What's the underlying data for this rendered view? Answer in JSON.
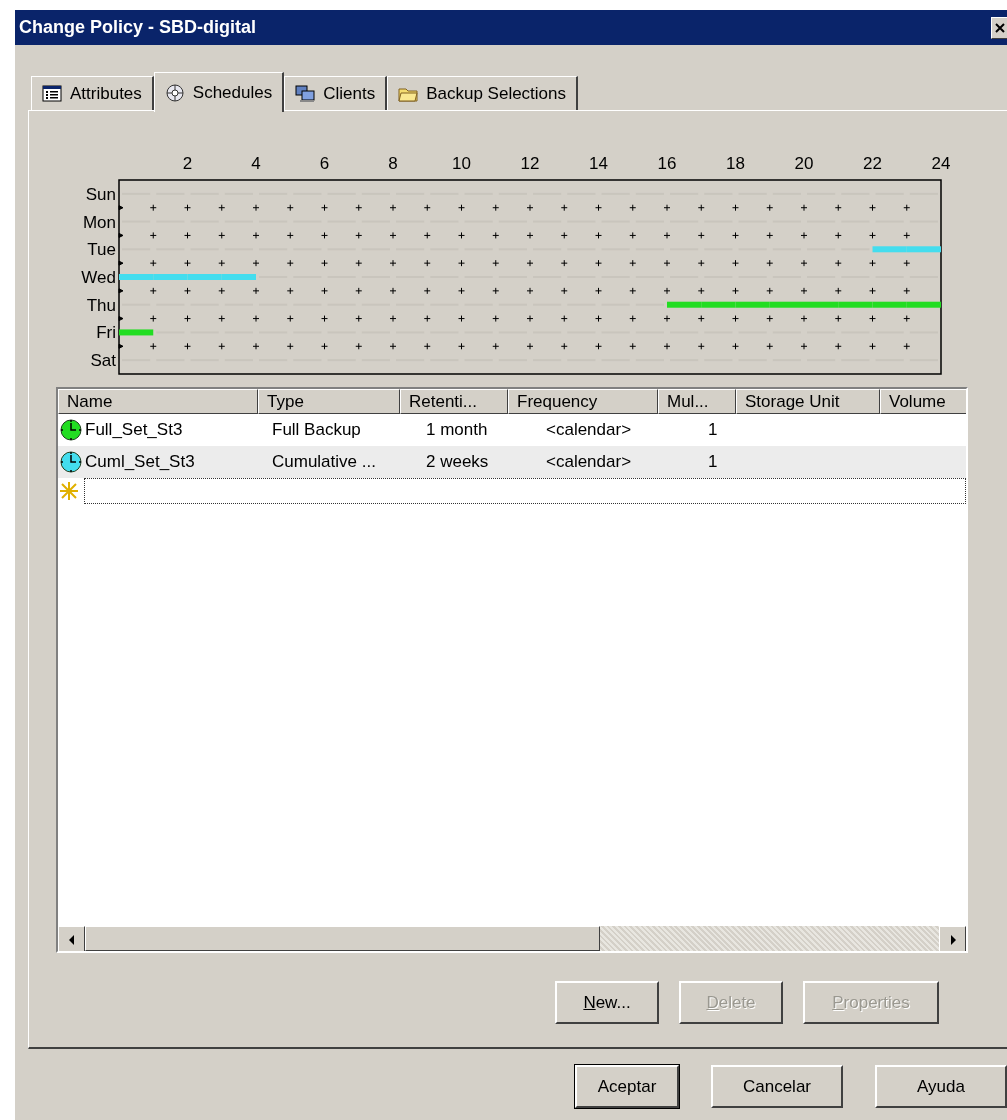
{
  "window": {
    "title": "Change Policy - SBD-digital"
  },
  "tabs": [
    {
      "label": "Attributes",
      "selected": false
    },
    {
      "label": "Schedules",
      "selected": true
    },
    {
      "label": "Clients",
      "selected": false
    },
    {
      "label": "Backup Selections",
      "selected": false
    }
  ],
  "schedule_grid": {
    "hour_labels": [
      "2",
      "4",
      "6",
      "8",
      "10",
      "12",
      "14",
      "16",
      "18",
      "20",
      "22",
      "24"
    ],
    "days": [
      {
        "label": "Sun",
        "hours": [
          {
            "on": false
          },
          {
            "on": false
          },
          {
            "on": false
          },
          {
            "on": false
          },
          {
            "on": false
          },
          {
            "on": false
          },
          {
            "on": false
          },
          {
            "on": false
          },
          {
            "on": false
          },
          {
            "on": false
          },
          {
            "on": false
          },
          {
            "on": false
          },
          {
            "on": false
          },
          {
            "on": false
          },
          {
            "on": false
          },
          {
            "on": false
          },
          {
            "on": false
          },
          {
            "on": false
          },
          {
            "on": false
          },
          {
            "on": false
          },
          {
            "on": false
          },
          {
            "on": false
          },
          {
            "on": false
          },
          {
            "on": false
          }
        ]
      },
      {
        "label": "Mon",
        "hours": [
          {
            "on": false
          },
          {
            "on": false
          },
          {
            "on": false
          },
          {
            "on": false
          },
          {
            "on": false
          },
          {
            "on": false
          },
          {
            "on": false
          },
          {
            "on": false
          },
          {
            "on": false
          },
          {
            "on": false
          },
          {
            "on": false
          },
          {
            "on": false
          },
          {
            "on": false
          },
          {
            "on": false
          },
          {
            "on": false
          },
          {
            "on": false
          },
          {
            "on": false
          },
          {
            "on": false
          },
          {
            "on": false
          },
          {
            "on": false
          },
          {
            "on": false
          },
          {
            "on": false
          },
          {
            "on": false
          },
          {
            "on": false
          }
        ]
      },
      {
        "label": "Tue",
        "color": "#44ddee",
        "hours": [
          {
            "on": false
          },
          {
            "on": false
          },
          {
            "on": false
          },
          {
            "on": false
          },
          {
            "on": false
          },
          {
            "on": false
          },
          {
            "on": false
          },
          {
            "on": false
          },
          {
            "on": false
          },
          {
            "on": false
          },
          {
            "on": false
          },
          {
            "on": false
          },
          {
            "on": false
          },
          {
            "on": false
          },
          {
            "on": false
          },
          {
            "on": false
          },
          {
            "on": false
          },
          {
            "on": false
          },
          {
            "on": false
          },
          {
            "on": false
          },
          {
            "on": false
          },
          {
            "on": false
          },
          {
            "on": true
          },
          {
            "on": true
          }
        ]
      },
      {
        "label": "Wed",
        "color": "#44ddee",
        "hours": [
          {
            "on": true
          },
          {
            "on": true
          },
          {
            "on": true
          },
          {
            "on": true
          },
          {
            "on": false
          },
          {
            "on": false
          },
          {
            "on": false
          },
          {
            "on": false
          },
          {
            "on": false
          },
          {
            "on": false
          },
          {
            "on": false
          },
          {
            "on": false
          },
          {
            "on": false
          },
          {
            "on": false
          },
          {
            "on": false
          },
          {
            "on": false
          },
          {
            "on": false
          },
          {
            "on": false
          },
          {
            "on": false
          },
          {
            "on": false
          },
          {
            "on": false
          },
          {
            "on": false
          },
          {
            "on": false
          },
          {
            "on": false
          }
        ]
      },
      {
        "label": "Thu",
        "color": "#22dd22",
        "hours": [
          {
            "on": false
          },
          {
            "on": false
          },
          {
            "on": false
          },
          {
            "on": false
          },
          {
            "on": false
          },
          {
            "on": false
          },
          {
            "on": false
          },
          {
            "on": false
          },
          {
            "on": false
          },
          {
            "on": false
          },
          {
            "on": false
          },
          {
            "on": false
          },
          {
            "on": false
          },
          {
            "on": false
          },
          {
            "on": false
          },
          {
            "on": false
          },
          {
            "on": true
          },
          {
            "on": true
          },
          {
            "on": true
          },
          {
            "on": true
          },
          {
            "on": true
          },
          {
            "on": true
          },
          {
            "on": true
          },
          {
            "on": true
          }
        ]
      },
      {
        "label": "Fri",
        "color": "#22dd22",
        "hours": [
          {
            "on": true
          },
          {
            "on": false
          },
          {
            "on": false
          },
          {
            "on": false
          },
          {
            "on": false
          },
          {
            "on": false
          },
          {
            "on": false
          },
          {
            "on": false
          },
          {
            "on": false
          },
          {
            "on": false
          },
          {
            "on": false
          },
          {
            "on": false
          },
          {
            "on": false
          },
          {
            "on": false
          },
          {
            "on": false
          },
          {
            "on": false
          },
          {
            "on": false
          },
          {
            "on": false
          },
          {
            "on": false
          },
          {
            "on": false
          },
          {
            "on": false
          },
          {
            "on": false
          },
          {
            "on": false
          },
          {
            "on": false
          }
        ]
      },
      {
        "label": "Sat",
        "hours": [
          {
            "on": false
          },
          {
            "on": false
          },
          {
            "on": false
          },
          {
            "on": false
          },
          {
            "on": false
          },
          {
            "on": false
          },
          {
            "on": false
          },
          {
            "on": false
          },
          {
            "on": false
          },
          {
            "on": false
          },
          {
            "on": false
          },
          {
            "on": false
          },
          {
            "on": false
          },
          {
            "on": false
          },
          {
            "on": false
          },
          {
            "on": false
          },
          {
            "on": false
          },
          {
            "on": false
          },
          {
            "on": false
          },
          {
            "on": false
          },
          {
            "on": false
          },
          {
            "on": false
          },
          {
            "on": false
          },
          {
            "on": false
          }
        ]
      }
    ]
  },
  "table": {
    "columns": [
      "Name",
      "Type",
      "Retenti...",
      "Frequency",
      "Mul...",
      "Storage Unit",
      "Volume"
    ],
    "rows": [
      {
        "color": "#22dd22",
        "selected": false,
        "cells": [
          "Full_Set_St3",
          "Full Backup",
          "1 month",
          "<calendar>",
          "1",
          "",
          ""
        ]
      },
      {
        "color": "#44ddee",
        "selected": true,
        "cells": [
          "Cuml_Set_St3",
          "Cumulative ...",
          "2 weeks",
          "<calendar>",
          "1",
          "",
          ""
        ]
      }
    ]
  },
  "schedule_buttons": [
    {
      "label": "New...",
      "underlined_first_letter": true,
      "disabled": false
    },
    {
      "label": "Delete",
      "underlined_first_letter": true,
      "disabled": true
    },
    {
      "label": "Properties",
      "underlined_first_letter": true,
      "disabled": true
    }
  ],
  "dialog_buttons": [
    {
      "label": "Aceptar",
      "default": true
    },
    {
      "label": "Cancelar",
      "default": false
    },
    {
      "label": "Ayuda",
      "default": false
    }
  ]
}
